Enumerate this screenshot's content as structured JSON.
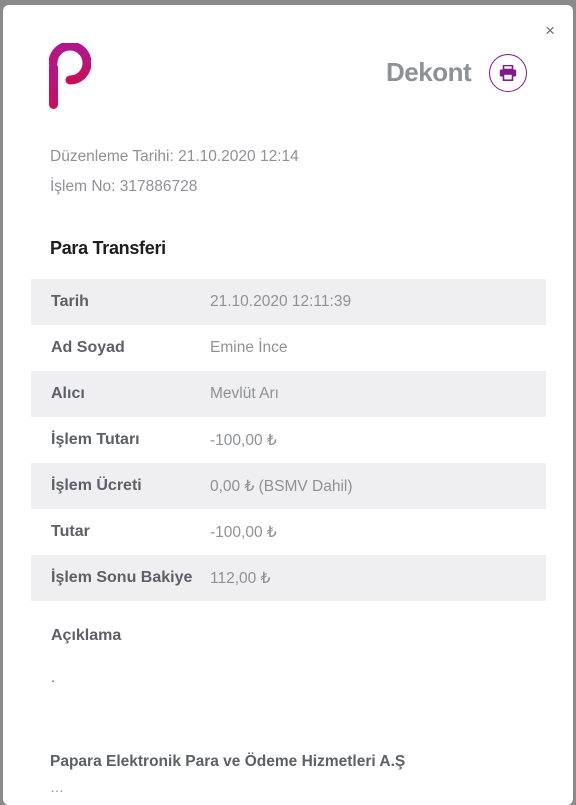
{
  "close_icon": "×",
  "header": {
    "title": "Dekont",
    "print_icon": "printer-icon",
    "logo_icon": "papara-logo-icon"
  },
  "meta": {
    "date": "Düzenleme Tarihi: 21.10.2020 12:14",
    "transaction_no": "İşlem No: 317886728"
  },
  "section_title": "Para Transferi",
  "rows": [
    {
      "label": "Tarih",
      "value": "21.10.2020 12:11:39"
    },
    {
      "label": "Ad Soyad",
      "value": "Emine İnce"
    },
    {
      "label": "Alıcı",
      "value": "Mevlüt Arı"
    },
    {
      "label": "İşlem Tutarı",
      "value": "-100,00 ₺"
    },
    {
      "label": "İşlem Ücreti",
      "value": "0,00 ₺ (BSMV Dahil)"
    },
    {
      "label": "Tutar",
      "value": "-100,00 ₺"
    },
    {
      "label": "İşlem Sonu Bakiye",
      "value": "112,00 ₺"
    }
  ],
  "description": {
    "label": "Açıklama",
    "value": "."
  },
  "footer": {
    "company": "Papara Elektronik Para ve Ödeme Hizmetleri A.Ş",
    "subline": "…"
  },
  "colors": {
    "brand_magenta": "#c2187d",
    "brand_purple": "#7f1a8a",
    "row_shade": "#efeff1"
  }
}
